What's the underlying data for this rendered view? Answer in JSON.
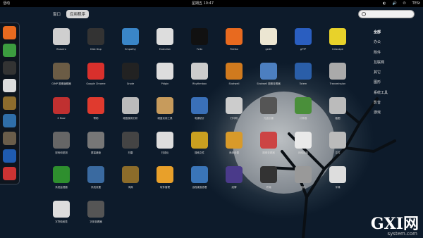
{
  "topbar": {
    "activities": "活动",
    "clock": "星期五 10:47",
    "tray": [
      "◐",
      "🔊",
      "⏻",
      "TESt"
    ]
  },
  "tabs": {
    "windows": "窗口",
    "apps": "应用程序"
  },
  "search": {
    "placeholder": ""
  },
  "categories": [
    "全部",
    "办公",
    "附件",
    "互联网",
    "其它",
    "图形",
    "系统工具",
    "影音",
    "游戏"
  ],
  "dash": [
    {
      "name": "firefox-icon",
      "color": "#e86a1f"
    },
    {
      "name": "chrome-icon",
      "color": "#3c9c3f"
    },
    {
      "name": "terminal-icon",
      "color": "#333"
    },
    {
      "name": "text-editor-icon",
      "color": "#ddd"
    },
    {
      "name": "books-icon",
      "color": "#8d6c2d"
    },
    {
      "name": "swirl-icon",
      "color": "#2f6ea8"
    },
    {
      "name": "gimp-icon",
      "color": "#6a5d4a"
    },
    {
      "name": "dictionary-icon",
      "color": "#1f5bb0"
    },
    {
      "name": "installer-icon",
      "color": "#c33"
    }
  ],
  "apps": [
    {
      "label": "Brasero",
      "color": "#cfcfcf"
    },
    {
      "label": "Disk Dup",
      "color": "#333"
    },
    {
      "label": "Empathy",
      "color": "#3a86c8"
    },
    {
      "label": "Evolution",
      "color": "#ddd"
    },
    {
      "label": "Fcitx",
      "color": "#111"
    },
    {
      "label": "Firefox",
      "color": "#e86a1f"
    },
    {
      "label": "gedit",
      "color": "#ece6d2"
    },
    {
      "label": "gFTP",
      "color": "#2a5ec0"
    },
    {
      "label": "Inkscape",
      "color": "#e8d22a"
    },
    {
      "label": "GIMP 图像编辑器",
      "color": "#6b5c45"
    },
    {
      "label": "Google Chrome",
      "color": "#d9302c"
    },
    {
      "label": "Gnote",
      "color": "#222"
    },
    {
      "label": "Pidgin",
      "color": "#ddd"
    },
    {
      "label": "Rhythmbox",
      "color": "#ccc"
    },
    {
      "label": "Shotwell",
      "color": "#d07a1e"
    },
    {
      "label": "Shotwell 图像查看器",
      "color": "#4c7fc0"
    },
    {
      "label": "Totem",
      "color": "#2a5ea8"
    },
    {
      "label": "Transmission",
      "color": "#aaa"
    },
    {
      "label": "X Now",
      "color": "#c03030"
    },
    {
      "label": "帮助",
      "color": "#e03a2e"
    },
    {
      "label": "磁盘使用分析",
      "color": "#bbb"
    },
    {
      "label": "磁盘实用工具",
      "color": "#c79b5c"
    },
    {
      "label": "电源统计",
      "color": "#3a70b8"
    },
    {
      "label": "打印机",
      "color": "#ccc"
    },
    {
      "label": "光盘创建",
      "color": "#555"
    },
    {
      "label": "计算器",
      "color": "#4a8f3a"
    },
    {
      "label": "截图",
      "color": "#bbb"
    },
    {
      "label": "密码和密钥",
      "color": "#666"
    },
    {
      "label": "屏幕键盘",
      "color": "#777"
    },
    {
      "label": "扫雷",
      "color": "#444"
    },
    {
      "label": "扫描仪",
      "color": "#ddd"
    },
    {
      "label": "搜索文件",
      "color": "#caa020"
    },
    {
      "label": "系统设置",
      "color": "#d89a2a"
    },
    {
      "label": "图像查看器",
      "color": "#cc4444"
    },
    {
      "label": "网络连接",
      "color": "#e9e9e9"
    },
    {
      "label": "文件",
      "color": "#bbb"
    },
    {
      "label": "系统监视器",
      "color": "#2e8f2e"
    },
    {
      "label": "系统设置",
      "color": "#3a6aa0"
    },
    {
      "label": "词典",
      "color": "#8c6c2a"
    },
    {
      "label": "软件管理",
      "color": "#e8a02a"
    },
    {
      "label": "远程桌面查看",
      "color": "#3a75b8"
    },
    {
      "label": "纸牌",
      "color": "#4a3a8a"
    },
    {
      "label": "终端",
      "color": "#333"
    },
    {
      "label": "相机",
      "color": "#999"
    },
    {
      "label": "字典",
      "color": "#ddd"
    },
    {
      "label": "字符映射表",
      "color": "#ddd"
    },
    {
      "label": "字体查看器",
      "color": "#555"
    }
  ]
}
